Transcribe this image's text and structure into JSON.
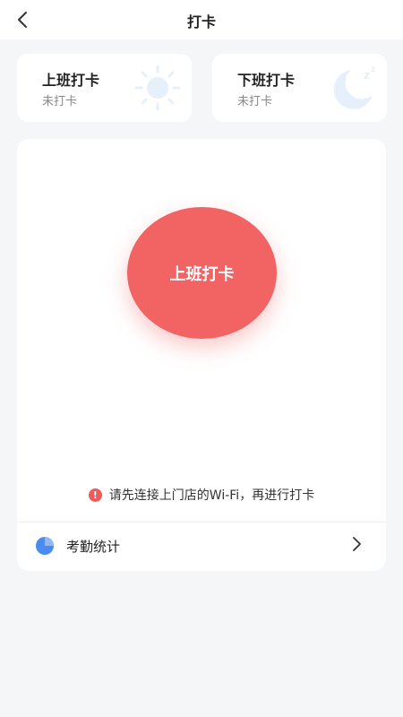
{
  "nav": {
    "title": "打卡"
  },
  "status_cards": {
    "clock_in": {
      "title": "上班打卡",
      "status": "未打卡"
    },
    "clock_out": {
      "title": "下班打卡",
      "status": "未打卡"
    }
  },
  "punch": {
    "label": "上班打卡",
    "color": "#f26363"
  },
  "notice": {
    "text": "请先连接上门店的Wi-Fi，再进行打卡",
    "icon": "!"
  },
  "stats": {
    "label": "考勤统计"
  },
  "colors": {
    "accent_red": "#f26363",
    "accent_blue": "#4a8cf0",
    "background": "#f5f6f8"
  }
}
